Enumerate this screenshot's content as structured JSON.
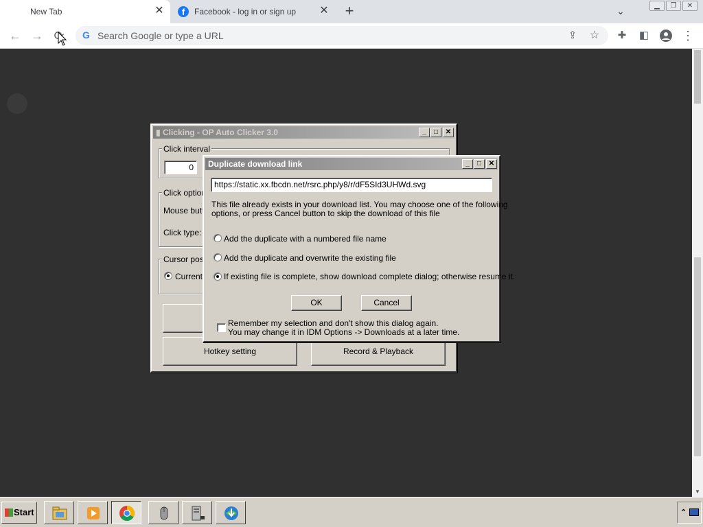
{
  "browser": {
    "tabs": [
      {
        "label": "New Tab",
        "active": true
      },
      {
        "label": "Facebook - log in or sign up",
        "active": false
      }
    ],
    "omnibox_placeholder": "Search Google or type a URL",
    "omnibox_value": ""
  },
  "autoclicker": {
    "title": "Clicking - OP Auto Clicker 3.0",
    "click_interval_label": "Click interval",
    "interval_value": "0",
    "click_options_label": "Click options",
    "mouse_button_label": "Mouse butto",
    "click_type_label": "Click type:",
    "cursor_position_label": "Cursor positi",
    "current_location_label": "Current l",
    "hotkey_button": "Hotkey setting",
    "record_button": "Record & Playback"
  },
  "idm_dialog": {
    "title": "Duplicate download link",
    "url": "https://static.xx.fbcdn.net/rsrc.php/y8/r/dF5SId3UHWd.svg",
    "message_line1": "This file already exists in your download list. You may choose one of the following",
    "message_line2": "options, or press Cancel button to skip the download of this file",
    "options": [
      {
        "label": "Add the duplicate with a numbered file name",
        "selected": false
      },
      {
        "label": "Add the duplicate and overwrite the existing file",
        "selected": false
      },
      {
        "label": "If existing file is complete, show download complete dialog; otherwise resume it.",
        "selected": true
      }
    ],
    "ok_label": "OK",
    "cancel_label": "Cancel",
    "remember_line1": "Remember my selection and don't show this dialog again.",
    "remember_line2": "You may change it in IDM Options -> Downloads at a later time.",
    "remember_checked": false
  },
  "taskbar": {
    "start_label": "Start",
    "icons": [
      "file-manager-icon",
      "media-player-icon",
      "chrome-icon",
      "mouse-icon",
      "server-icon",
      "idm-icon"
    ]
  }
}
